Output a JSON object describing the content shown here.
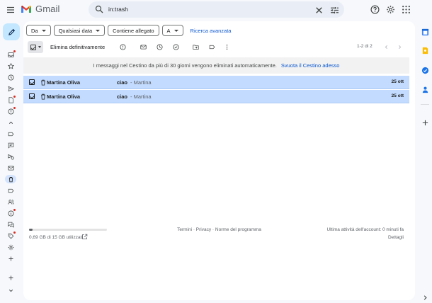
{
  "header": {
    "logo_text": "Gmail",
    "search_query": "in:trash"
  },
  "filters": {
    "chips": [
      "Da",
      "Qualsiasi data",
      "Contiene allegato",
      "A"
    ],
    "advanced_search": "Ricerca avanzata"
  },
  "toolbar": {
    "delete_forever": "Elimina definitivamente",
    "pager": "1-2 di 2"
  },
  "notice": {
    "text": "I messaggi nel Cestino da più di 30 giorni vengono eliminati automaticamente.",
    "link": "Svuota il Cestino adesso"
  },
  "messages": [
    {
      "sender": "Martina Oliva",
      "subject": "ciao",
      "snippet": " - Martina",
      "date": "25 ott"
    },
    {
      "sender": "Martina Oliva",
      "subject": "ciao",
      "snippet": " - Martina",
      "date": "25 ott"
    }
  ],
  "footer": {
    "storage_text": "0,69 GB di 15 GB utilizzati",
    "storage_fraction": 0.046,
    "terms": "Termini · Privacy · Norme del programma",
    "activity": "Ultima attività dell'account: 0 minuti fa",
    "details": "Dettagli"
  },
  "colors": {
    "accent": "#0b57d0",
    "compose": "#c2e7ff",
    "selected_row": "#c2dbff",
    "notification_dot": "#d93025"
  }
}
